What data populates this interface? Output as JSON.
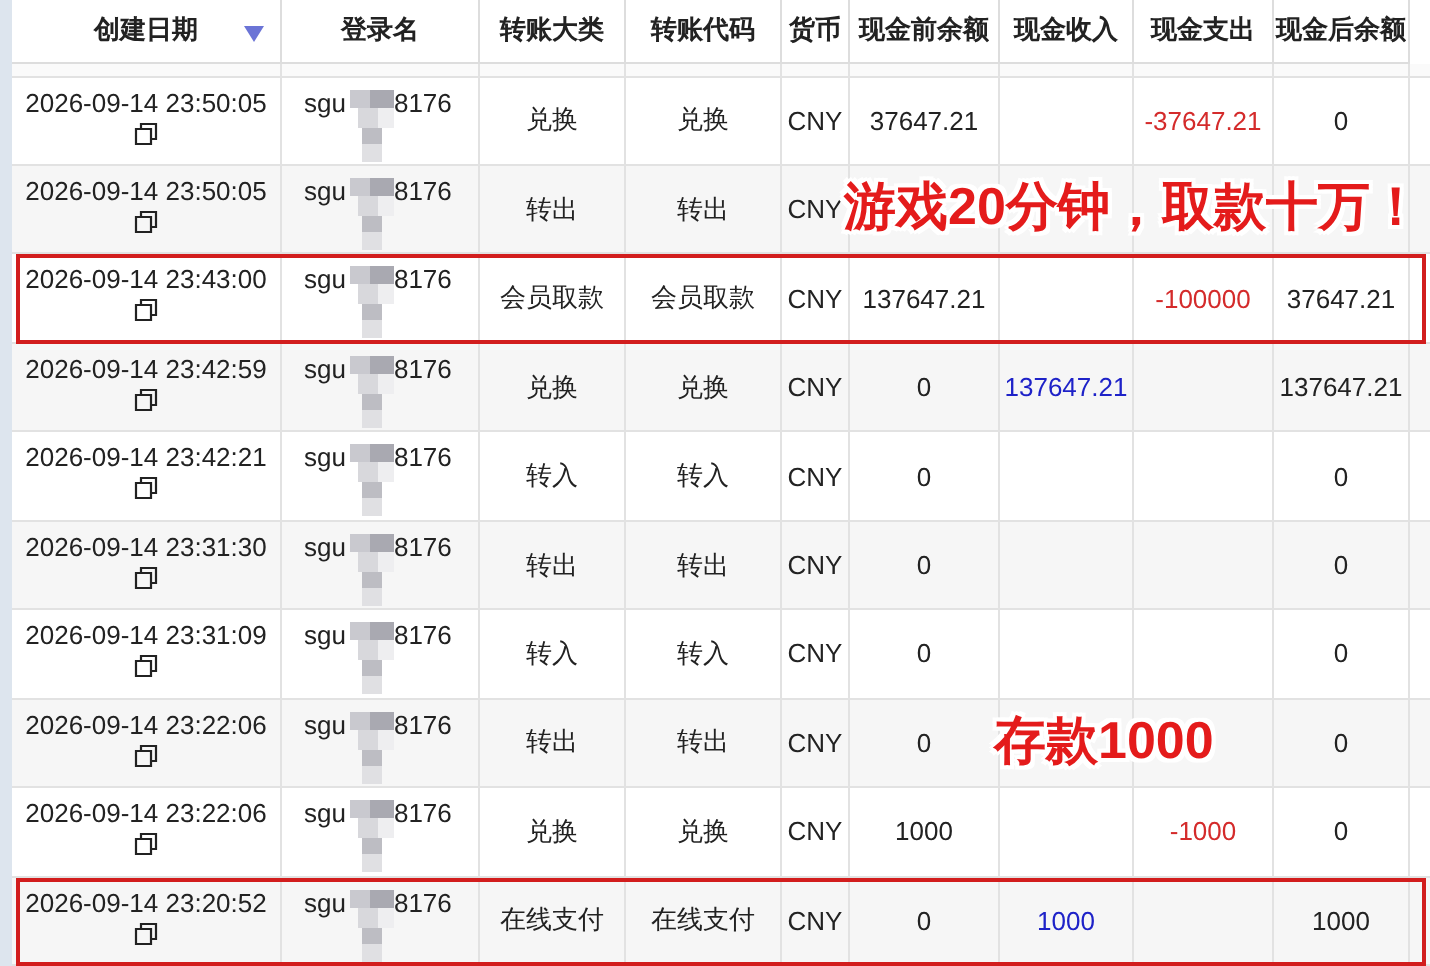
{
  "table": {
    "columns": [
      {
        "label": "创建日期",
        "sorted": true
      },
      {
        "label": "登录名",
        "sorted": false
      },
      {
        "label": "转账大类",
        "sorted": false
      },
      {
        "label": "转账代码",
        "sorted": false
      },
      {
        "label": "货币",
        "sorted": false
      },
      {
        "label": "现金前余额",
        "sorted": false
      },
      {
        "label": "现金收入",
        "sorted": false
      },
      {
        "label": "现金支出",
        "sorted": false
      },
      {
        "label": "现金后余额",
        "sorted": false
      }
    ],
    "rows": [
      {
        "date": "2026-09-14 23:50:05",
        "login": {
          "prefix": "sgu",
          "suffix": "8176"
        },
        "category": "兑换",
        "code": "兑换",
        "currency": "CNY",
        "before": "37647.21",
        "expense": "-37647.21",
        "after": "0",
        "highlighted": false
      },
      {
        "date": "2026-09-14 23:50:05",
        "login": {
          "prefix": "sgu",
          "suffix": "8176"
        },
        "category": "转出",
        "code": "转出",
        "currency": "CNY",
        "highlighted": false,
        "annotation": "游戏20分钟，取款十万！"
      },
      {
        "date": "2026-09-14 23:43:00",
        "login": {
          "prefix": "sgu",
          "suffix": "8176"
        },
        "category": "会员取款",
        "code": "会员取款",
        "currency": "CNY",
        "before": "137647.21",
        "expense": "-100000",
        "after": "37647.21",
        "highlighted": true
      },
      {
        "date": "2026-09-14 23:42:59",
        "login": {
          "prefix": "sgu",
          "suffix": "8176"
        },
        "category": "兑换",
        "code": "兑换",
        "currency": "CNY",
        "before": "0",
        "income": "137647.21",
        "after": "137647.21",
        "highlighted": false
      },
      {
        "date": "2026-09-14 23:42:21",
        "login": {
          "prefix": "sgu",
          "suffix": "8176"
        },
        "category": "转入",
        "code": "转入",
        "currency": "CNY",
        "before": "0",
        "after": "0",
        "highlighted": false
      },
      {
        "date": "2026-09-14 23:31:30",
        "login": {
          "prefix": "sgu",
          "suffix": "8176"
        },
        "category": "转出",
        "code": "转出",
        "currency": "CNY",
        "before": "0",
        "after": "0",
        "highlighted": false
      },
      {
        "date": "2026-09-14 23:31:09",
        "login": {
          "prefix": "sgu",
          "suffix": "8176"
        },
        "category": "转入",
        "code": "转入",
        "currency": "CNY",
        "before": "0",
        "after": "0",
        "highlighted": false
      },
      {
        "date": "2026-09-14 23:22:06",
        "login": {
          "prefix": "sgu",
          "suffix": "8176"
        },
        "category": "转出",
        "code": "转出",
        "currency": "CNY",
        "before": "0",
        "after": "0",
        "highlighted": false,
        "annotation": "存款1000"
      },
      {
        "date": "2026-09-14 23:22:06",
        "login": {
          "prefix": "sgu",
          "suffix": "8176"
        },
        "category": "兑换",
        "code": "兑换",
        "currency": "CNY",
        "before": "1000",
        "expense": "-1000",
        "after": "0",
        "highlighted": false
      },
      {
        "date": "2026-09-14 23:20:52",
        "login": {
          "prefix": "sgu",
          "suffix": "8176"
        },
        "category": "在线支付",
        "code": "在线支付",
        "currency": "CNY",
        "before": "0",
        "income": "1000",
        "after": "1000",
        "highlighted": true
      }
    ]
  }
}
